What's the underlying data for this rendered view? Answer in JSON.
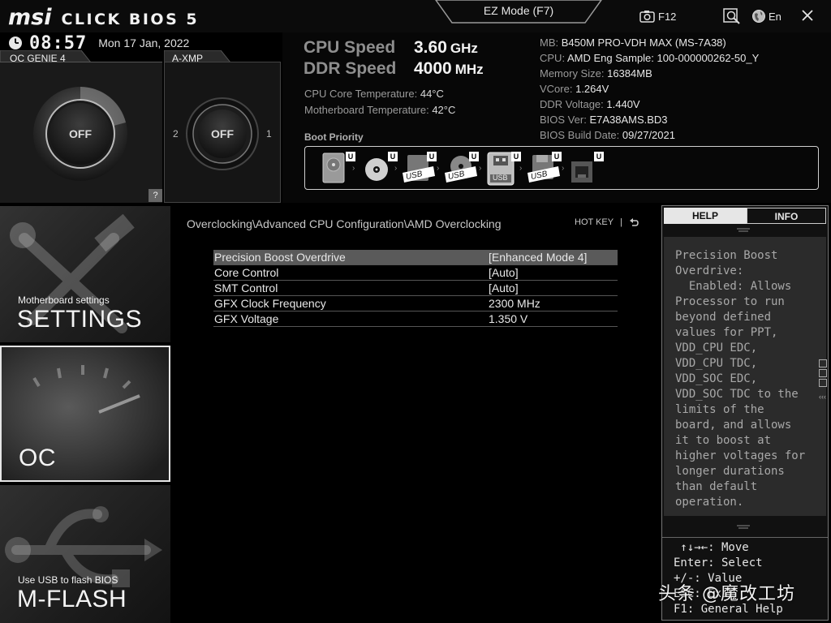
{
  "header": {
    "logo_brand": "msi",
    "logo_product": "CLICK BIOS 5",
    "ez_mode_label": "EZ Mode (F7)",
    "screenshot_key": "F12",
    "language": "En",
    "icons": [
      "camera-icon",
      "search-icon",
      "globe-icon",
      "close-icon"
    ]
  },
  "clock": {
    "time": "08:57",
    "date": "Mon  17 Jan, 2022"
  },
  "oc_genie": {
    "label": "OC GENIE 4",
    "state": "OFF",
    "help": "?"
  },
  "axmp": {
    "label": "A-XMP",
    "state": "OFF",
    "profile_left": "2",
    "profile_right": "1"
  },
  "speeds": {
    "cpu_label": "CPU Speed",
    "cpu_value": "3.60",
    "cpu_unit": "GHz",
    "ddr_label": "DDR Speed",
    "ddr_value": "4000",
    "ddr_unit": "MHz"
  },
  "temps": {
    "cpu_label": "CPU Core Temperature:",
    "cpu_value": "44°C",
    "mb_label": "Motherboard Temperature:",
    "mb_value": "42°C"
  },
  "system_info": [
    {
      "label": "MB:",
      "value": "B450M PRO-VDH MAX (MS-7A38)"
    },
    {
      "label": "CPU:",
      "value": "AMD Eng Sample: 100-000000262-50_Y"
    },
    {
      "label": "Memory Size:",
      "value": "16384MB"
    },
    {
      "label": "VCore:",
      "value": "1.264V"
    },
    {
      "label": "DDR Voltage:",
      "value": "1.440V"
    },
    {
      "label": "BIOS Ver:",
      "value": "E7A38AMS.BD3"
    },
    {
      "label": "BIOS Build Date:",
      "value": "09/27/2021"
    }
  ],
  "boot": {
    "label": "Boot Priority",
    "devices": [
      {
        "icon": "hdd-icon",
        "badge": "U",
        "text": ""
      },
      {
        "icon": "optical-disc-icon",
        "badge": "U",
        "text": ""
      },
      {
        "icon": "usb-hdd-icon",
        "badge": "U",
        "text": "USB"
      },
      {
        "icon": "usb-cd-icon",
        "badge": "U",
        "text": "USB"
      },
      {
        "icon": "usb-key-icon",
        "badge": "U",
        "text": "USB"
      },
      {
        "icon": "usb-floppy-icon",
        "badge": "U",
        "text": "USB"
      },
      {
        "icon": "network-icon",
        "badge": "U",
        "text": ""
      }
    ]
  },
  "nav": {
    "settings_sub": "Motherboard settings",
    "settings_title": "SETTINGS",
    "oc_title": "OC",
    "mflash_sub": "Use USB to flash BIOS",
    "mflash_title": "M-FLASH"
  },
  "main": {
    "breadcrumb": "Overclocking\\Advanced CPU Configuration\\AMD Overclocking",
    "hotkey": "HOT KEY",
    "separator": "|",
    "settings": [
      {
        "name": "Precision Boost Overdrive",
        "value": "[Enhanced Mode 4]",
        "selected": true
      },
      {
        "name": "Core Control",
        "value": "[Auto]",
        "selected": false
      },
      {
        "name": "SMT Control",
        "value": "[Auto]",
        "selected": false
      },
      {
        "name": "GFX Clock Frequency",
        "value": "2300 MHz",
        "selected": false
      },
      {
        "name": "GFX Voltage",
        "value": "1.350 V",
        "selected": false
      }
    ]
  },
  "help_panel": {
    "tab_help": "HELP",
    "tab_info": "INFO",
    "text": "Precision Boost\nOverdrive:\n  Enabled: Allows\nProcessor to run\nbeyond defined\nvalues for PPT,\nVDD_CPU EDC,\nVDD_CPU TDC,\nVDD_SOC EDC,\nVDD_SOC TDC to the\nlimits of the\nboard, and allows\nit to boost at\nhigher voltages for\nlonger durations\nthan default\noperation.",
    "keys": " ↑↓→←: Move\nEnter: Select\n+/-: Value\nESC: Exit\nF1: General Help"
  },
  "watermark": "头条 @魔改工坊"
}
